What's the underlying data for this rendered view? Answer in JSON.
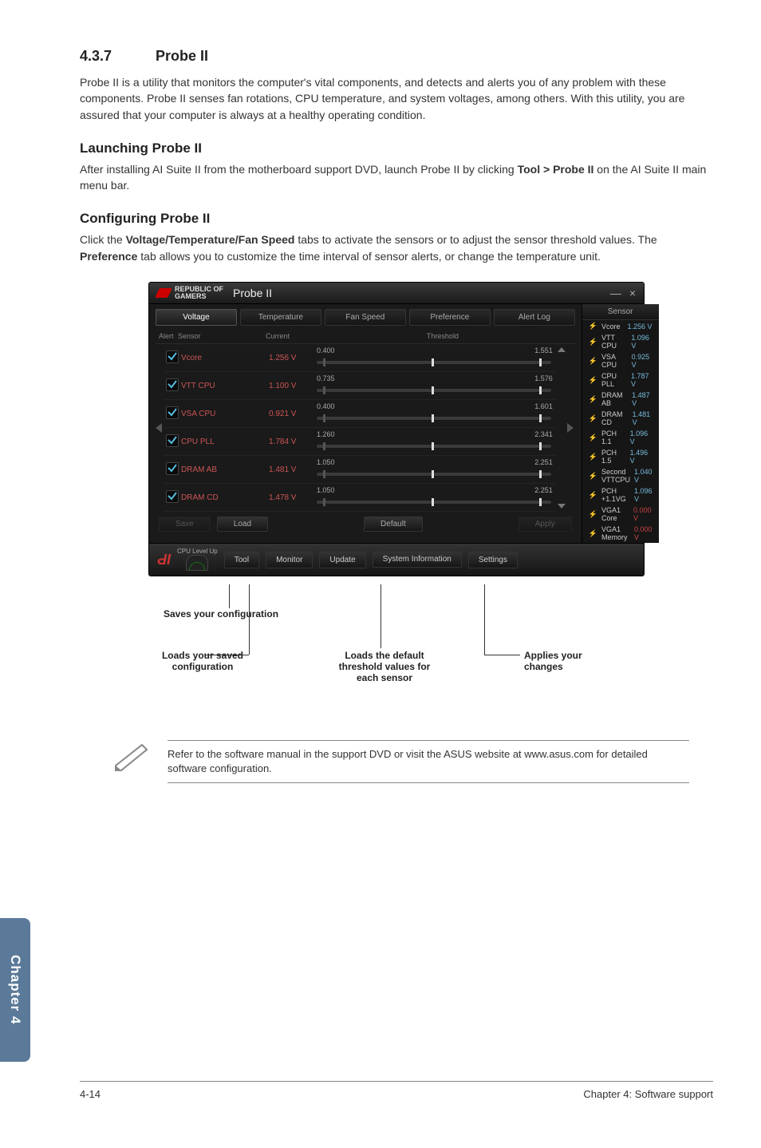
{
  "section": {
    "num": "4.3.7",
    "title": "Probe II"
  },
  "intro": "Probe II is a utility that monitors the computer's vital components, and detects and alerts you of any problem with these components. Probe II senses fan rotations, CPU temperature, and system voltages, among others. With this utility, you are assured that your computer is always at a healthy operating condition.",
  "launch": {
    "heading": "Launching Probe II",
    "text_pre": "After installing AI Suite II from the motherboard support DVD, launch Probe II by clicking ",
    "bold": "Tool > Probe II",
    "text_post": " on the AI Suite II main menu bar."
  },
  "config": {
    "heading": "Configuring Probe II",
    "pre1": "Click the ",
    "b1": "Voltage/Temperature/Fan Speed",
    "mid1": " tabs to activate the sensors or to adjust the sensor threshold values. The ",
    "b2": "Preference",
    "post1": " tab allows you to customize the time interval of sensor alerts, or change the temperature unit."
  },
  "app": {
    "brand1": "REPUBLIC OF",
    "brand2": "GAMERS",
    "title": "Probe II",
    "tabs": [
      "Voltage",
      "Temperature",
      "Fan Speed",
      "Preference",
      "Alert Log"
    ],
    "head": {
      "alert": "Alert",
      "sensor": "Sensor",
      "current": "Current",
      "threshold": "Threshold"
    },
    "rows": [
      {
        "name": "Vcore",
        "cur": "1.256 V",
        "lo": "0.400",
        "hi": "1.551"
      },
      {
        "name": "VTT CPU",
        "cur": "1.100 V",
        "lo": "0.735",
        "hi": "1.576"
      },
      {
        "name": "VSA CPU",
        "cur": "0.921 V",
        "lo": "0.400",
        "hi": "1.601"
      },
      {
        "name": "CPU PLL",
        "cur": "1.784 V",
        "lo": "1.260",
        "hi": "2.341"
      },
      {
        "name": "DRAM AB",
        "cur": "1.481 V",
        "lo": "1.050",
        "hi": "2.251"
      },
      {
        "name": "DRAM CD",
        "cur": "1.478 V",
        "lo": "1.050",
        "hi": "2.251"
      }
    ],
    "btns": {
      "save": "Save",
      "load": "Load",
      "def": "Default",
      "apply": "Apply"
    },
    "sensor_hdr": "Sensor",
    "sensors": [
      {
        "n": "Vcore",
        "v": "1.256 V",
        "dim": false
      },
      {
        "n": "VTT CPU",
        "v": "1.096 V",
        "dim": false
      },
      {
        "n": "VSA CPU",
        "v": "0.925 V",
        "dim": false
      },
      {
        "n": "CPU PLL",
        "v": "1.787 V",
        "dim": false
      },
      {
        "n": "DRAM AB",
        "v": "1.487 V",
        "dim": false
      },
      {
        "n": "DRAM CD",
        "v": "1.481 V",
        "dim": false
      },
      {
        "n": "PCH 1.1",
        "v": "1.096 V",
        "dim": false
      },
      {
        "n": "PCH 1.5",
        "v": "1.496 V",
        "dim": false
      },
      {
        "n": "Second VTTCPU",
        "v": "1.040 V",
        "dim": false
      },
      {
        "n": "PCH +1.1VG",
        "v": "1.096 V",
        "dim": false
      },
      {
        "n": "VGA1 Core",
        "v": "0.000 V",
        "dim": true
      },
      {
        "n": "VGA1 Memory",
        "v": "0.000 V",
        "dim": true
      }
    ],
    "footer": {
      "cpu": "CPU Level Up",
      "tool": "Tool",
      "monitor": "Monitor",
      "update": "Update",
      "sysinfo": "System Information",
      "settings": "Settings"
    }
  },
  "callouts": {
    "saves": "Saves your configuration",
    "loads": "Loads your saved configuration",
    "def": "Loads the default threshold values for each sensor",
    "apply": "Applies your changes"
  },
  "note": "Refer to the software manual in the support DVD or visit the ASUS website at www.asus.com for detailed software configuration.",
  "chapter_tab": "Chapter 4",
  "footer": {
    "left": "4-14",
    "right": "Chapter 4: Software support"
  }
}
